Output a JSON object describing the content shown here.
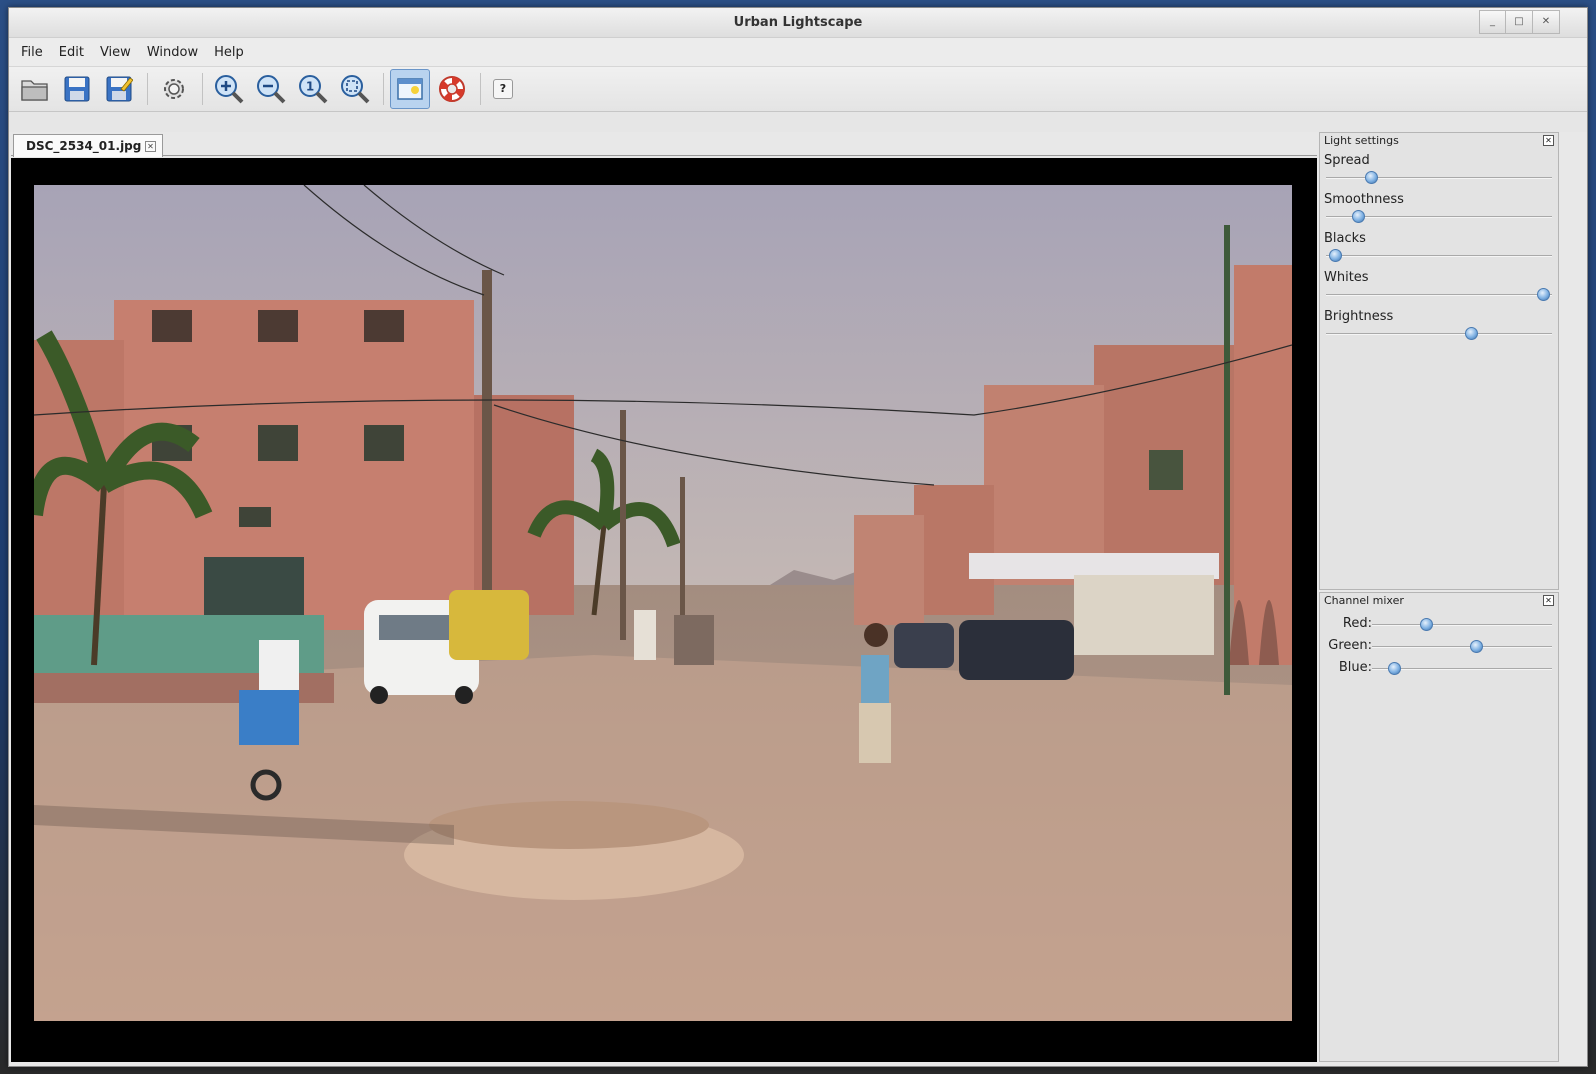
{
  "window": {
    "title": "Urban Lightscape",
    "controls": [
      "_",
      "□",
      "✕"
    ]
  },
  "menu": [
    "File",
    "Edit",
    "View",
    "Window",
    "Help"
  ],
  "toolbar": {
    "help_label": "?"
  },
  "document": {
    "tab_label": "DSC_2534_01.jpg",
    "tab_close": "✕"
  },
  "light_settings": {
    "title": "Light settings",
    "close": "✕",
    "sliders": [
      {
        "label": "Spread",
        "value": 0.2
      },
      {
        "label": "Smoothness",
        "value": 0.14
      },
      {
        "label": "Blacks",
        "value": 0.04
      },
      {
        "label": "Whites",
        "value": 0.96
      },
      {
        "label": "Brightness",
        "value": 0.64
      }
    ]
  },
  "channel_mixer": {
    "title": "Channel mixer",
    "close": "✕",
    "sliders": [
      {
        "label": "Red:",
        "value": 0.3
      },
      {
        "label": "Green:",
        "value": 0.58
      },
      {
        "label": "Blue:",
        "value": 0.12
      }
    ]
  },
  "colors": {
    "accent": "#6a95c8",
    "canvas_bg": "#000000",
    "knob": "#7fb1e3"
  }
}
